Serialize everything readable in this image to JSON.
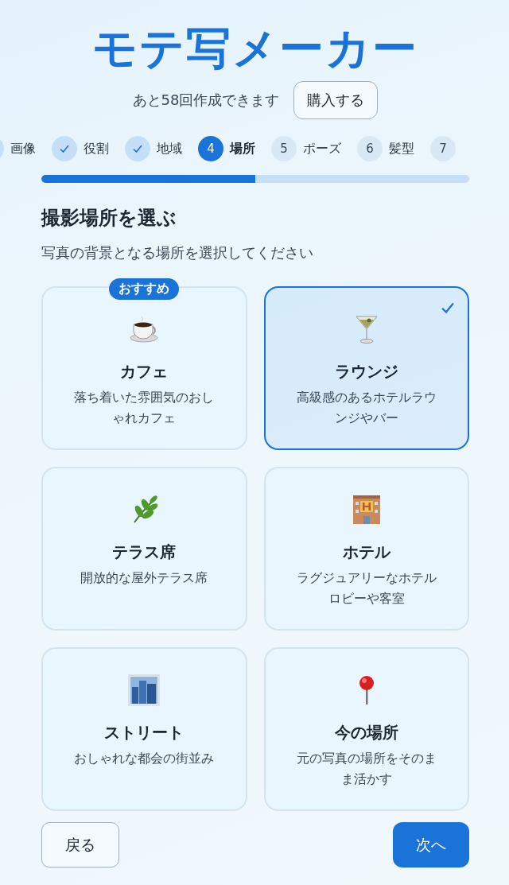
{
  "app_title": "モテ写メーカー",
  "credits": {
    "text": "あと58回作成できます",
    "button": "購入する"
  },
  "steps": [
    {
      "label": "画像",
      "kind": "cut"
    },
    {
      "label": "役割",
      "kind": "done"
    },
    {
      "label": "地域",
      "kind": "done"
    },
    {
      "number": "4",
      "label": "場所",
      "kind": "current"
    },
    {
      "number": "5",
      "label": "ポーズ",
      "kind": "upcoming"
    },
    {
      "number": "6",
      "label": "髪型",
      "kind": "upcoming"
    },
    {
      "number": "7",
      "kind": "upcoming"
    }
  ],
  "progress": {
    "level": 0.5
  },
  "heading": "撮影場所を選ぶ",
  "subheading": "写真の背景となる場所を選択してください",
  "options": [
    {
      "title": "カフェ",
      "description": "落ち着いた雰囲気のおしゃれカフェ",
      "badge": "おすすめ",
      "selected": false
    },
    {
      "title": "ラウンジ",
      "description": "高級感のあるホテルラウンジやバー",
      "selected": true
    },
    {
      "title": "テラス席",
      "description": "開放的な屋外テラス席",
      "selected": false
    },
    {
      "title": "ホテル",
      "description": "ラグジュアリーなホテルロビーや客室",
      "selected": false
    },
    {
      "title": "ストリート",
      "description": "おしゃれな都会の街並み",
      "selected": false
    },
    {
      "title": "今の場所",
      "description": "元の写真の場所をそのまま活かす",
      "selected": false
    }
  ],
  "buttons": {
    "back": "戻る",
    "next": "次へ"
  }
}
